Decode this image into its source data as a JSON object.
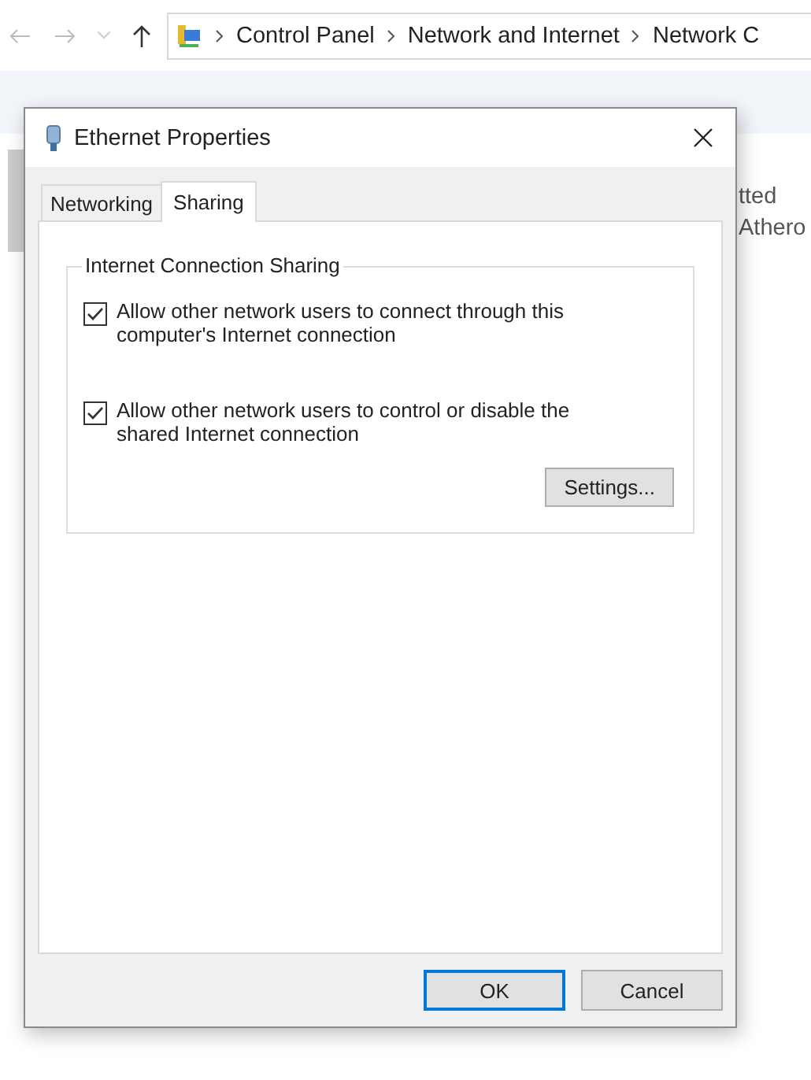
{
  "explorer": {
    "breadcrumbs": [
      "Control Panel",
      "Network and Internet",
      "Network C"
    ],
    "details": [
      "tted",
      "Athero"
    ]
  },
  "dialog": {
    "title": "Ethernet Properties",
    "tabs": [
      {
        "label": "Networking",
        "selected": false
      },
      {
        "label": "Sharing",
        "selected": true
      }
    ],
    "group": {
      "title": "Internet Connection Sharing",
      "options": [
        {
          "label": "Allow other network users to connect through this computer's Internet connection",
          "checked": true
        },
        {
          "label": "Allow other network users to control or disable the shared Internet connection",
          "checked": true
        }
      ],
      "button": "Settings..."
    },
    "buttons": [
      {
        "label": "OK",
        "default": true
      },
      {
        "label": "Cancel",
        "default": false
      }
    ]
  }
}
